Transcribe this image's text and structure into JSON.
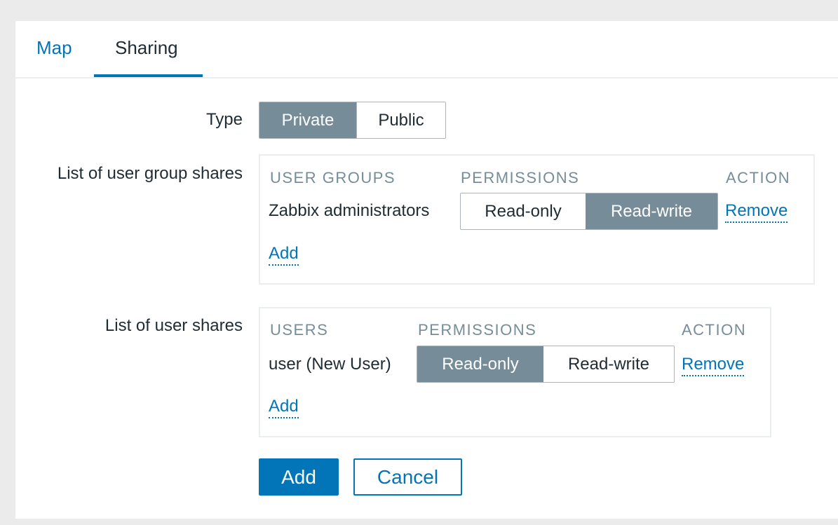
{
  "tabs": [
    {
      "label": "Map",
      "active": false
    },
    {
      "label": "Sharing",
      "active": true
    }
  ],
  "form": {
    "type": {
      "label": "Type",
      "options": [
        "Private",
        "Public"
      ],
      "selected": "Private"
    },
    "user_group_shares": {
      "label": "List of user group shares",
      "headers": {
        "name": "USER GROUPS",
        "permissions": "PERMISSIONS",
        "action": "ACTION"
      },
      "rows": [
        {
          "name": "Zabbix administrators",
          "options": [
            "Read-only",
            "Read-write"
          ],
          "selected": "Read-write",
          "action": "Remove"
        }
      ],
      "add_label": "Add"
    },
    "user_shares": {
      "label": "List of user shares",
      "headers": {
        "name": "USERS",
        "permissions": "PERMISSIONS",
        "action": "ACTION"
      },
      "rows": [
        {
          "name": "user (New User)",
          "options": [
            "Read-only",
            "Read-write"
          ],
          "selected": "Read-only",
          "action": "Remove"
        }
      ],
      "add_label": "Add"
    },
    "buttons": {
      "submit": "Add",
      "cancel": "Cancel"
    }
  },
  "colors": {
    "accent": "#0275b8",
    "segment_active": "#768d99",
    "header_text": "#768d99"
  }
}
